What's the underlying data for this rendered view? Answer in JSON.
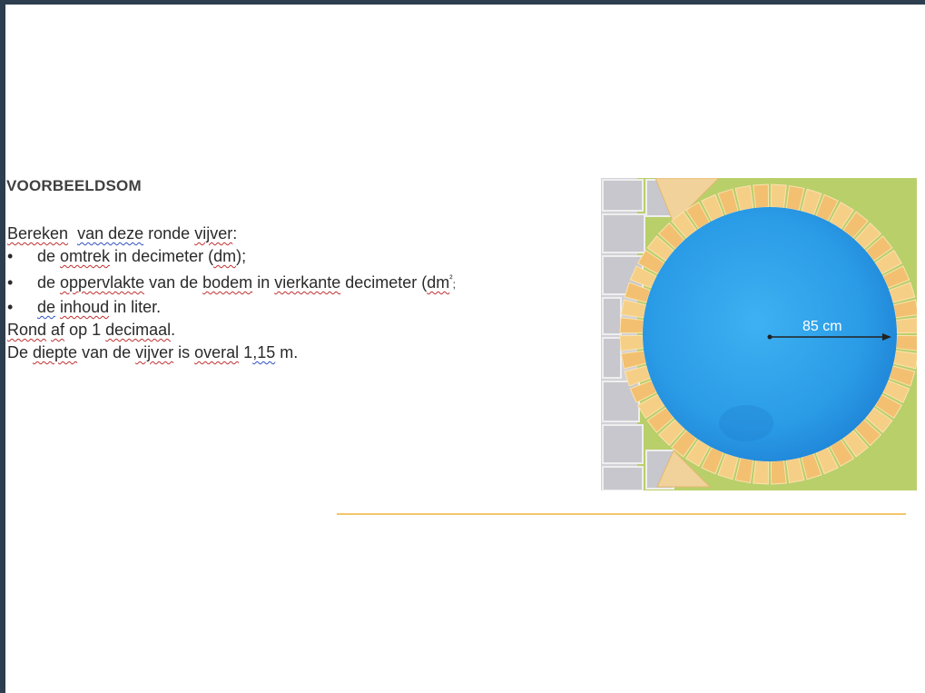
{
  "slide": {
    "heading": "VOORBEELDSOM",
    "intro": [
      "Bereken",
      "van deze",
      "ronde",
      "vijver",
      ":"
    ],
    "bullets": [
      {
        "bullet": "•",
        "parts": [
          "de ",
          "omtrek",
          " in decimeter  (",
          "dm",
          ");"
        ]
      },
      {
        "bullet": "•",
        "parts": [
          "de ",
          "oppervlakte",
          " van de ",
          "bodem",
          " in ",
          "vierkante",
          " decimeter (",
          "dm",
          "²",
          ";"
        ]
      },
      {
        "bullet": "•",
        "parts": [
          "de",
          " ",
          "inhoud",
          " in liter."
        ]
      }
    ],
    "round": [
      "Rond",
      " ",
      "af",
      " op 1 ",
      "decimaal",
      "."
    ],
    "depth": [
      "De ",
      "diepte",
      " van de ",
      "vijver",
      " is ",
      "overal",
      " 1",
      ",15",
      " m."
    ]
  },
  "figure": {
    "radius_label": "85 cm",
    "colors": {
      "grass": "#b9cf6a",
      "paving": "#c9c9cf",
      "tile": "#f4c77a",
      "water": "#2aa0e8",
      "water_dark": "#1d7fd0"
    }
  },
  "accent": {
    "divider_color": "#f2c66a",
    "frame_color": "#2d3f4f"
  }
}
